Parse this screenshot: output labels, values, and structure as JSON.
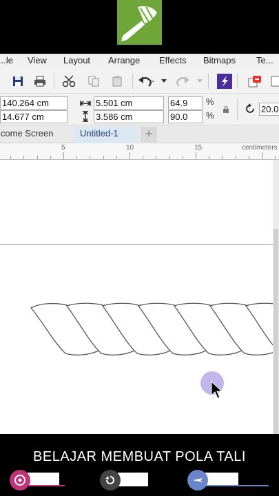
{
  "menubar": {
    "items": [
      "...le",
      "View",
      "Layout",
      "Arrange",
      "Effects",
      "Bitmaps",
      "Te..."
    ]
  },
  "propbar": {
    "pos_x": "140.264 cm",
    "pos_y": "14.677 cm",
    "width": "5.501 cm",
    "height": "3.586 cm",
    "scale_x": "64.9",
    "scale_y": "90.0",
    "percent": "%",
    "rotation": "20.0"
  },
  "tabs": {
    "welcome": "lcome Screen",
    "active": "Untitled-1",
    "add": "+"
  },
  "ruler": {
    "numbers": [
      "5",
      "10",
      "15"
    ],
    "unit": "centimeters"
  },
  "caption": {
    "text": "BELAJAR MEMBUAT POLA TALI"
  },
  "colors": {
    "logo_green": "#6ea63a",
    "tab_active_bg": "#dce7f4",
    "cursor_highlight": "#b8a9e6",
    "chip1": "#c0337a",
    "chip2": "#444444",
    "chip3": "#6b86c8"
  },
  "icons": [
    "save-icon",
    "print-icon",
    "cut-icon",
    "copy-icon",
    "paste-icon",
    "undo-icon",
    "redo-icon",
    "publish-icon",
    "import-icon",
    "lock-icon",
    "rotate-icon"
  ]
}
